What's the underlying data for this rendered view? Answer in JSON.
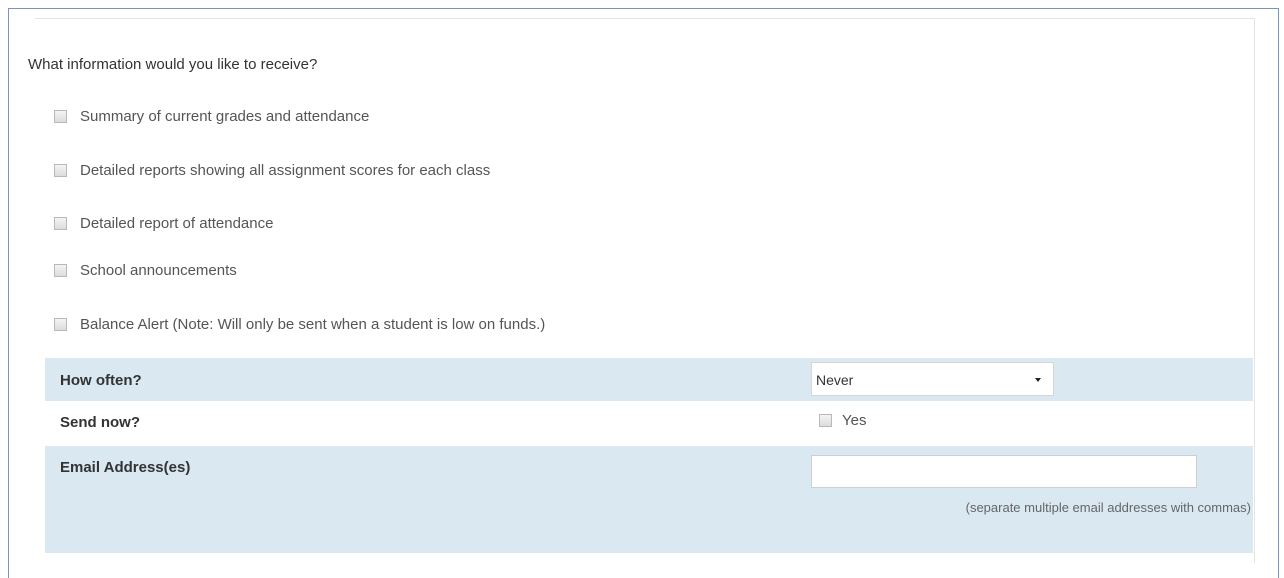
{
  "question": "What information would you like to receive?",
  "options": [
    {
      "label": "Summary of current grades and attendance",
      "checked": false
    },
    {
      "label": "Detailed reports showing all assignment scores for each class",
      "checked": false
    },
    {
      "label": "Detailed report of attendance",
      "checked": false
    },
    {
      "label": "School announcements",
      "checked": false
    },
    {
      "label": "Balance Alert (Note: Will only be sent when a student is low on funds.)",
      "checked": false
    }
  ],
  "frequency": {
    "label": "How often?",
    "selected": "Never"
  },
  "send_now": {
    "label": "Send now?",
    "option_label": "Yes",
    "checked": false
  },
  "email": {
    "label": "Email Address(es)",
    "value": "",
    "hint": "(separate multiple email addresses with commas)"
  },
  "colors": {
    "row_highlight": "#d9e8f1",
    "frame_border": "#7a95bd"
  }
}
